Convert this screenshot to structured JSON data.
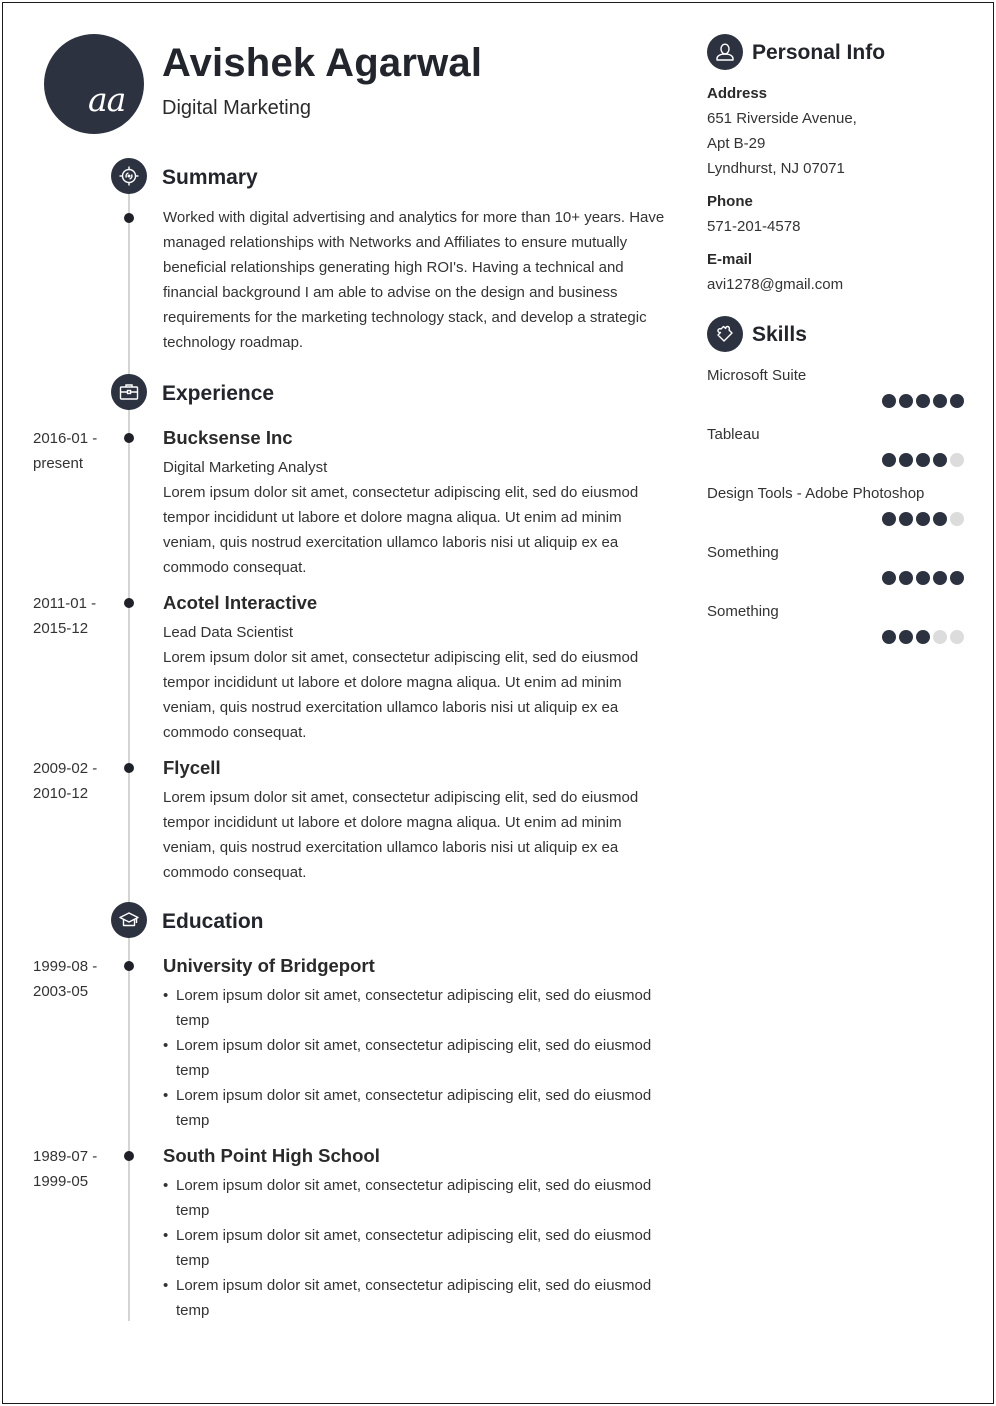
{
  "header": {
    "avatar_initials": "aa",
    "name": "Avishek Agarwal",
    "role": "Digital Marketing"
  },
  "summary": {
    "title": "Summary",
    "icon": "target-icon",
    "text": "Worked with digital advertising and analytics for more than 10+ years. Have managed relationships with Networks and Affiliates to ensure mutually beneficial relationships generating high ROI's. Having a technical and financial background I am able to advise on the design and business requirements for the marketing technology stack, and develop a strategic technology roadmap."
  },
  "experience": {
    "title": "Experience",
    "icon": "briefcase-icon",
    "items": [
      {
        "date_start": "2016-01 -",
        "date_end": "present",
        "company": "Bucksense Inc",
        "position": "Digital Marketing Analyst",
        "description": "Lorem ipsum dolor sit amet, consectetur adipiscing elit, sed do eiusmod tempor incididunt ut labore et dolore magna aliqua. Ut enim ad minim veniam, quis nostrud exercitation ullamco laboris nisi ut aliquip ex ea commodo consequat."
      },
      {
        "date_start": "2011-01 -",
        "date_end": "2015-12",
        "company": "Acotel Interactive",
        "position": "Lead Data Scientist",
        "description": "Lorem ipsum dolor sit amet, consectetur adipiscing elit, sed do eiusmod tempor incididunt ut labore et dolore magna aliqua. Ut enim ad minim veniam, quis nostrud exercitation ullamco laboris nisi ut aliquip ex ea commodo consequat."
      },
      {
        "date_start": "2009-02 -",
        "date_end": "2010-12",
        "company": "Flycell",
        "description": "Lorem ipsum dolor sit amet, consectetur adipiscing elit, sed do eiusmod tempor incididunt ut labore et dolore magna aliqua. Ut enim ad minim veniam, quis nostrud exercitation ullamco laboris nisi ut aliquip ex ea commodo consequat."
      }
    ]
  },
  "education": {
    "title": "Education",
    "icon": "graduation-cap-icon",
    "items": [
      {
        "date_start": "1999-08 -",
        "date_end": "2003-05",
        "school": "University of Bridgeport",
        "bullets": [
          "Lorem ipsum dolor sit amet, consectetur adipiscing elit, sed do eiusmod temp",
          "Lorem ipsum dolor sit amet, consectetur adipiscing elit, sed do eiusmod temp",
          "Lorem ipsum dolor sit amet, consectetur adipiscing elit, sed do eiusmod temp"
        ]
      },
      {
        "date_start": "1989-07 -",
        "date_end": "1999-05",
        "school": "South Point High School",
        "bullets": [
          "Lorem ipsum dolor sit amet, consectetur adipiscing elit, sed do eiusmod temp",
          "Lorem ipsum dolor sit amet, consectetur adipiscing elit, sed do eiusmod temp",
          "Lorem ipsum dolor sit amet, consectetur adipiscing elit, sed do eiusmod temp"
        ]
      }
    ]
  },
  "personal_info": {
    "title": "Personal Info",
    "icon": "user-icon",
    "address_label": "Address",
    "address_lines": [
      "651 Riverside Avenue,",
      "Apt B-29",
      "Lyndhurst, NJ 07071"
    ],
    "phone_label": "Phone",
    "phone": "571-201-4578",
    "email_label": "E-mail",
    "email": "avi1278@gmail.com"
  },
  "skills": {
    "title": "Skills",
    "icon": "puzzle-icon",
    "max_level": 5,
    "items": [
      {
        "name": "Microsoft Suite",
        "level": 5
      },
      {
        "name": "Tableau",
        "level": 4
      },
      {
        "name": "Design Tools - Adobe Photoshop",
        "level": 4
      },
      {
        "name": "Something",
        "level": 5
      },
      {
        "name": "Something",
        "level": 3
      }
    ]
  },
  "colors": {
    "accent_dark": "#2c3240",
    "timeline_line": "#d4d4d4",
    "dot_empty": "#dcdcdc",
    "text": "#333333"
  }
}
